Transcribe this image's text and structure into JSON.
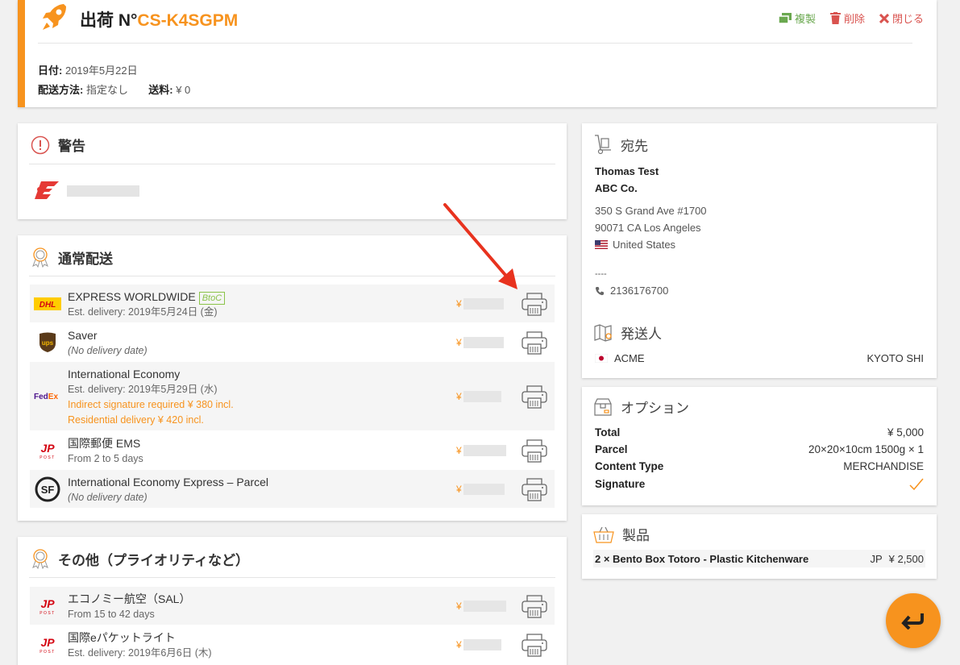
{
  "header": {
    "title_prefix": "出荷 N°",
    "shipment_code": "CS-K4SGPM",
    "actions": {
      "copy": "複製",
      "delete": "削除",
      "close": "閉じる"
    },
    "date_label": "日付:",
    "date_value": "2019年5月22日",
    "method_label": "配送方法:",
    "method_value": "指定なし",
    "fee_label": "送料:",
    "fee_value": "¥ 0"
  },
  "warnings": {
    "title": "警告"
  },
  "normal_shipping": {
    "title": "通常配送",
    "rows": [
      {
        "carrier": "DHL",
        "name": "EXPRESS WORLDWIDE",
        "tag": "BtoC",
        "sub": "Est. delivery: 2019年5月24日 (金)",
        "price_symbol": "¥"
      },
      {
        "carrier": "UPS",
        "name": "Saver",
        "sub": "(No delivery date)",
        "price_symbol": "¥"
      },
      {
        "carrier": "FedEx",
        "name": "International Economy",
        "sub": "Est. delivery: 2019年5月29日 (水)",
        "warn1": "Indirect signature required ¥ 380 incl.",
        "warn2": "Residential delivery ¥ 420 incl.",
        "price_symbol": "¥"
      },
      {
        "carrier": "JP Post",
        "name": "国際郵便 EMS",
        "sub": "From 2 to 5 days",
        "price_symbol": "¥"
      },
      {
        "carrier": "SF",
        "name": "International Economy Express – Parcel",
        "sub": "(No delivery date)",
        "price_symbol": "¥"
      }
    ]
  },
  "other_shipping": {
    "title": "その他（プライオリティなど）",
    "rows": [
      {
        "carrier": "JP Post",
        "name": "エコノミー航空（SAL）",
        "sub": "From 15 to 42 days",
        "price_symbol": "¥"
      },
      {
        "carrier": "JP Post",
        "name": "国際eパケットライト",
        "sub": "Est. delivery: 2019年6月6日 (木)",
        "price_symbol": "¥"
      }
    ]
  },
  "destination": {
    "title": "宛先",
    "name": "Thomas Test",
    "company": "ABC Co.",
    "address1": "350 S Grand Ave #1700",
    "address2": "90071 CA Los Angeles",
    "country": "United States",
    "dashes": "----",
    "phone": "2136176700",
    "sender_title": "発送人",
    "sender_name": "ACME",
    "sender_city": "KYOTO SHI"
  },
  "options": {
    "title": "オプション",
    "total_label": "Total",
    "total_value": "¥ 5,000",
    "parcel_label": "Parcel",
    "parcel_value": "20×20×10cm 1500g × 1",
    "content_label": "Content Type",
    "content_value": "MERCHANDISE",
    "signature_label": "Signature"
  },
  "products": {
    "title": "製品",
    "item_name": "2 × Bento Box Totoro - Plastic Kitchenware",
    "item_origin": "JP",
    "item_price": "¥ 2,500"
  },
  "colors": {
    "accent": "#f7931e",
    "danger": "#d9534f",
    "success": "#6aa84f",
    "arrow": "#e8321e"
  },
  "icons": [
    "rocket-icon",
    "copy-icon",
    "trash-icon",
    "close-icon",
    "alert-icon",
    "award-icon",
    "printer-icon",
    "hand-truck-icon",
    "phone-icon",
    "map-icon",
    "box-icon",
    "basket-icon",
    "check-icon",
    "return-icon"
  ]
}
